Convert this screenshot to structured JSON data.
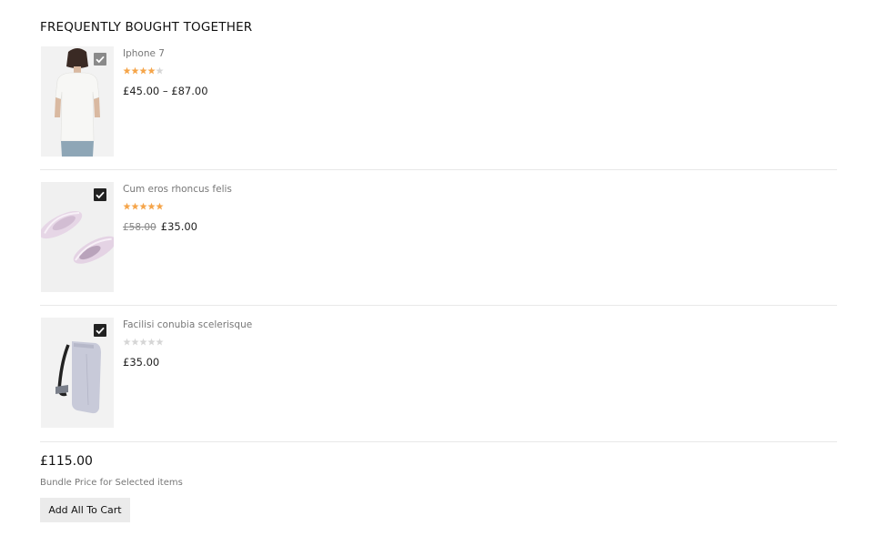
{
  "section": {
    "title": "FREQUENTLY BOUGHT TOGETHER"
  },
  "products": [
    {
      "name": "Iphone 7",
      "rating": 4,
      "rating_max": 5,
      "price": "£45.00 – £87.00",
      "old_price": "",
      "checked": true,
      "checkbox_disabled": true,
      "image_icon": "tshirt-model-image"
    },
    {
      "name": "Cum eros rhoncus felis",
      "rating": 5,
      "rating_max": 5,
      "price": "£35.00",
      "old_price": "£58.00",
      "checked": true,
      "checkbox_disabled": false,
      "image_icon": "sneakers-image"
    },
    {
      "name": "Facilisi conubia scelerisque",
      "rating": 0,
      "rating_max": 5,
      "price": "£35.00",
      "old_price": "",
      "checked": true,
      "checkbox_disabled": false,
      "image_icon": "backpack-image"
    }
  ],
  "bundle": {
    "total": "£115.00",
    "note": "Bundle Price for Selected items",
    "button_label": "Add All To Cart"
  },
  "colors": {
    "star_filled": "#f5a54a",
    "star_empty": "#d6d6d6",
    "checkbox": "#222222",
    "checkbox_disabled": "#8a8a8a"
  }
}
